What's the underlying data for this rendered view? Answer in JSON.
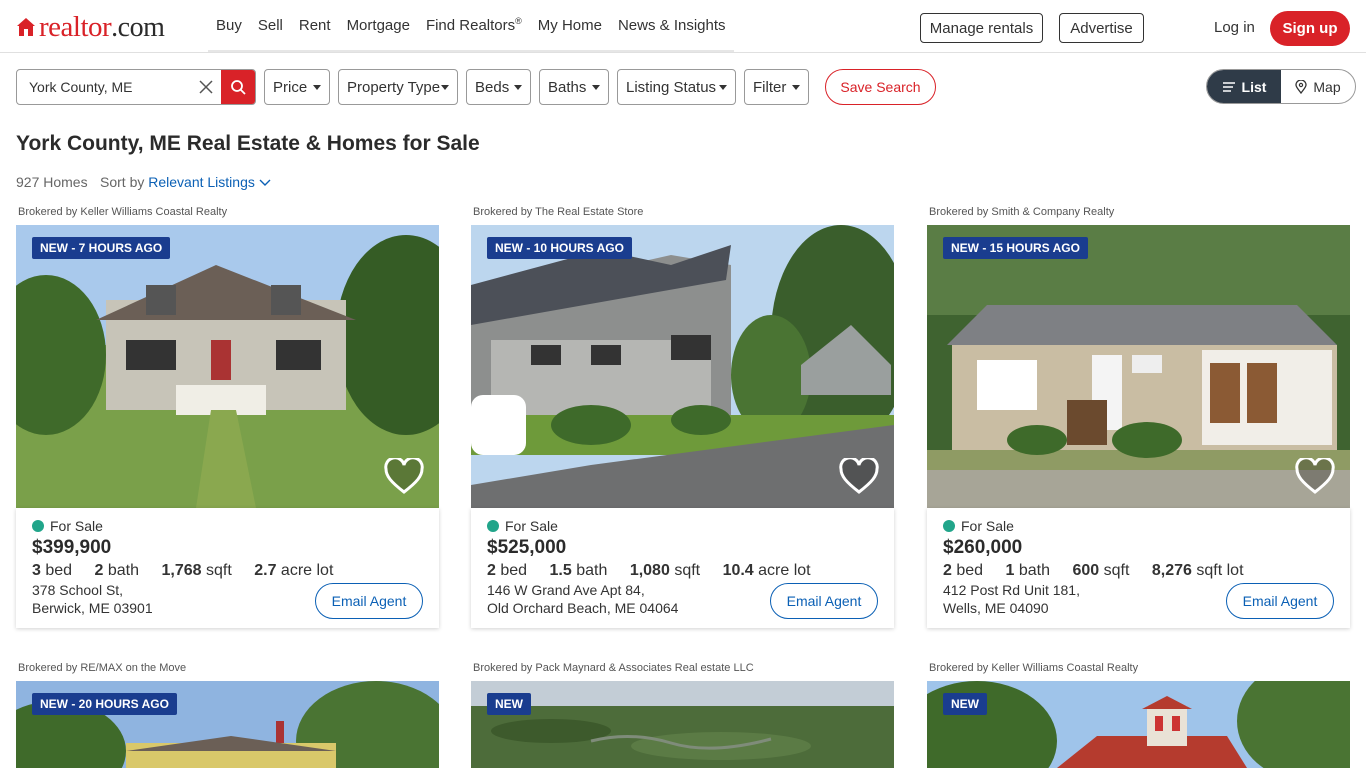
{
  "header": {
    "logo_main": "realtor",
    "logo_suffix": ".com",
    "nav": [
      "Buy",
      "Sell",
      "Rent",
      "Mortgage",
      "Find Realtors",
      "My Home",
      "News & Insights"
    ],
    "nav_registered": "®",
    "manage_rentals": "Manage rentals",
    "advertise": "Advertise",
    "login": "Log in",
    "signup": "Sign up"
  },
  "search": {
    "location": "York County, ME",
    "filters": [
      "Price",
      "Property Type",
      "Beds",
      "Baths",
      "Listing Status",
      "Filter"
    ],
    "save_search": "Save Search",
    "view_list": "List",
    "view_map": "Map"
  },
  "results": {
    "title": "York County, ME Real Estate & Homes for Sale",
    "count": "927 Homes",
    "sort_label": "Sort by",
    "sort_value": "Relevant Listings"
  },
  "listings": [
    {
      "broker": "Brokered by Keller Williams Coastal Realty",
      "badge": "NEW - 7 HOURS AGO",
      "status": "For Sale",
      "price": "$399,900",
      "beds": "3",
      "beds_unit": "bed",
      "baths": "2",
      "baths_unit": "bath",
      "sqft": "1,768",
      "sqft_unit": "sqft",
      "lot": "2.7",
      "lot_unit": "acre lot",
      "address_line1": "378 School St,",
      "address_line2": "Berwick, ME 03901",
      "cta": "Email Agent"
    },
    {
      "broker": "Brokered by The Real Estate Store",
      "badge": "NEW - 10 HOURS AGO",
      "status": "For Sale",
      "price": "$525,000",
      "beds": "2",
      "beds_unit": "bed",
      "baths": "1.5",
      "baths_unit": "bath",
      "sqft": "1,080",
      "sqft_unit": "sqft",
      "lot": "10.4",
      "lot_unit": "acre lot",
      "address_line1": "146 W Grand Ave Apt 84,",
      "address_line2": "Old Orchard Beach, ME 04064",
      "cta": "Email Agent"
    },
    {
      "broker": "Brokered by Smith & Company Realty",
      "badge": "NEW - 15 HOURS AGO",
      "status": "For Sale",
      "price": "$260,000",
      "beds": "2",
      "beds_unit": "bed",
      "baths": "1",
      "baths_unit": "bath",
      "sqft": "600",
      "sqft_unit": "sqft",
      "lot": "8,276",
      "lot_unit": "sqft lot",
      "address_line1": "412 Post Rd Unit 181,",
      "address_line2": "Wells, ME 04090",
      "cta": "Email Agent"
    },
    {
      "broker": "Brokered by RE/MAX on the Move",
      "badge": "NEW - 20 HOURS AGO"
    },
    {
      "broker": "Brokered by Pack Maynard & Associates Real estate LLC",
      "badge": "NEW"
    },
    {
      "broker": "Brokered by Keller Williams Coastal Realty",
      "badge": "NEW"
    }
  ],
  "colors": {
    "brand_red": "#d92228",
    "link_blue": "#0b60b5",
    "badge_blue": "#1a3d8f",
    "status_green": "#21a58a",
    "toggle_dark": "#2f3b48"
  }
}
